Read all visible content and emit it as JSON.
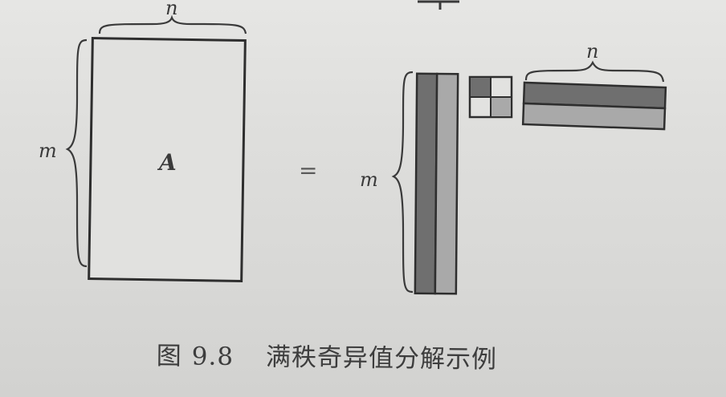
{
  "diagram": {
    "matrix_label": "A",
    "row_label": "m",
    "col_label": "n",
    "equals": "=",
    "right_row_label": "m",
    "right_col_label": "n"
  },
  "caption": {
    "prefix": "图",
    "number": "9.8",
    "text": "满秩奇异值分解示例"
  },
  "colors": {
    "dark_fill": "#6f6f6f",
    "light_fill": "#a9a9a9",
    "stroke": "#2e2e2e"
  }
}
